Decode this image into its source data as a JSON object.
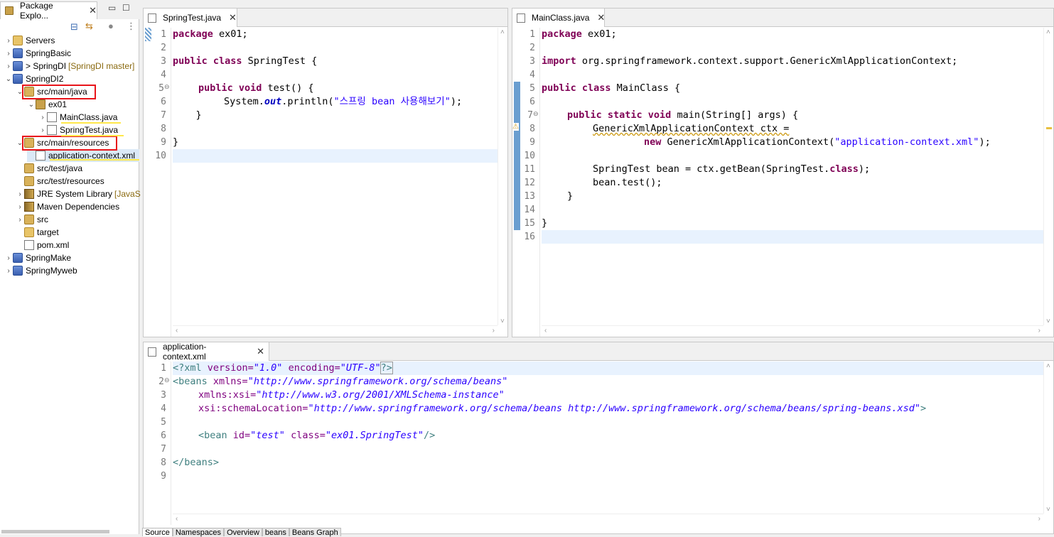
{
  "explorer": {
    "tab_label": "Package Explo...",
    "tree": [
      {
        "label": "Servers",
        "deco": ""
      },
      {
        "label": "SpringBasic",
        "deco": ""
      },
      {
        "label": "> SpringDI",
        "deco": "[SpringDI master]"
      },
      {
        "label": "SpringDI2",
        "deco": ""
      },
      {
        "label": "src/main/java",
        "deco": ""
      },
      {
        "label": "ex01",
        "deco": ""
      },
      {
        "label": "MainClass.java",
        "deco": ""
      },
      {
        "label": "SpringTest.java",
        "deco": ""
      },
      {
        "label": "src/main/resources",
        "deco": ""
      },
      {
        "label": "application-context.xml",
        "deco": ""
      },
      {
        "label": "src/test/java",
        "deco": ""
      },
      {
        "label": "src/test/resources",
        "deco": ""
      },
      {
        "label": "JRE System Library",
        "deco": "[JavaS"
      },
      {
        "label": "Maven Dependencies",
        "deco": ""
      },
      {
        "label": "src",
        "deco": ""
      },
      {
        "label": "target",
        "deco": ""
      },
      {
        "label": "pom.xml",
        "deco": ""
      },
      {
        "label": "SpringMake",
        "deco": ""
      },
      {
        "label": "SpringMyweb",
        "deco": ""
      }
    ]
  },
  "editor_springtest": {
    "tab_label": "SpringTest.java",
    "line_numbers": [
      "1",
      "2",
      "3",
      "4",
      "5",
      "6",
      "7",
      "8",
      "9",
      "10"
    ],
    "lines": [
      "package ex01;",
      "",
      "public class SpringTest {",
      "",
      "    public void test() {",
      "        System.out.println(\"스프링 bean 사용해보기\");",
      "    }",
      "",
      "}",
      ""
    ],
    "parts": {
      "l1_kw": "package",
      "l1_rest": " ex01;",
      "l3_kw": "public class",
      "l3_rest": " SpringTest {",
      "l5_kw": "public void",
      "l5_rest": " test() {",
      "l6_a": "System.",
      "l6_fld": "out",
      "l6_b": ".println(",
      "l6_str": "\"스프링 bean 사용해보기\"",
      "l6_c": ");",
      "l7": "    }",
      "l9": "}"
    }
  },
  "editor_mainclass": {
    "tab_label": "MainClass.java",
    "line_numbers": [
      "1",
      "2",
      "3",
      "4",
      "5",
      "6",
      "7",
      "8",
      "9",
      "10",
      "11",
      "12",
      "13",
      "14",
      "15",
      "16"
    ],
    "parts": {
      "l1_kw": "package",
      "l1_rest": " ex01;",
      "l3_kw": "import",
      "l3_rest": " org.springframework.context.support.GenericXmlApplicationContext;",
      "l5_kw": "public class",
      "l5_rest": " MainClass {",
      "l7_kw": "public static void",
      "l7_rest": " main(String[] args) {",
      "l8": "GenericXmlApplicationContext ctx =",
      "l9_kw": "new",
      "l9_a": " GenericXmlApplicationContext(",
      "l9_str": "\"application-context.xml\"",
      "l9_b": ");",
      "l11_a": "SpringTest bean = ctx.getBean(SpringTest.",
      "l11_kw": "class",
      "l11_b": ");",
      "l12": "bean.test();",
      "l13": "}",
      "l15": "}"
    }
  },
  "editor_xml": {
    "tab_label": "application-context.xml",
    "line_numbers": [
      "1",
      "2",
      "3",
      "4",
      "5",
      "6",
      "7",
      "8",
      "9"
    ],
    "parts": {
      "l1_a": "<?xml",
      "l1_attr1": " version=",
      "l1_val1": "\"1.0\"",
      "l1_attr2": " encoding=",
      "l1_val2": "\"UTF-8\"",
      "l1_b": "?>",
      "l2_a": "<beans",
      "l2_attr": " xmlns=",
      "l2_val": "\"http://www.springframework.org/schema/beans\"",
      "l3_attr": "xmlns:xsi=",
      "l3_val": "\"http://www.w3.org/2001/XMLSchema-instance\"",
      "l4_attr": "xsi:schemaLocation=",
      "l4_val": "\"http://www.springframework.org/schema/beans http://www.springframework.org/schema/beans/spring-beans.xsd\"",
      "l4_b": ">",
      "l6_a": "<bean",
      "l6_attr1": " id=",
      "l6_val1": "\"test\"",
      "l6_attr2": " class=",
      "l6_val2": "\"ex01.SpringTest\"",
      "l6_b": "/>",
      "l8": "</beans>"
    },
    "bottom_tabs": [
      "Source",
      "Namespaces",
      "Overview",
      "beans",
      "Beans Graph"
    ]
  }
}
